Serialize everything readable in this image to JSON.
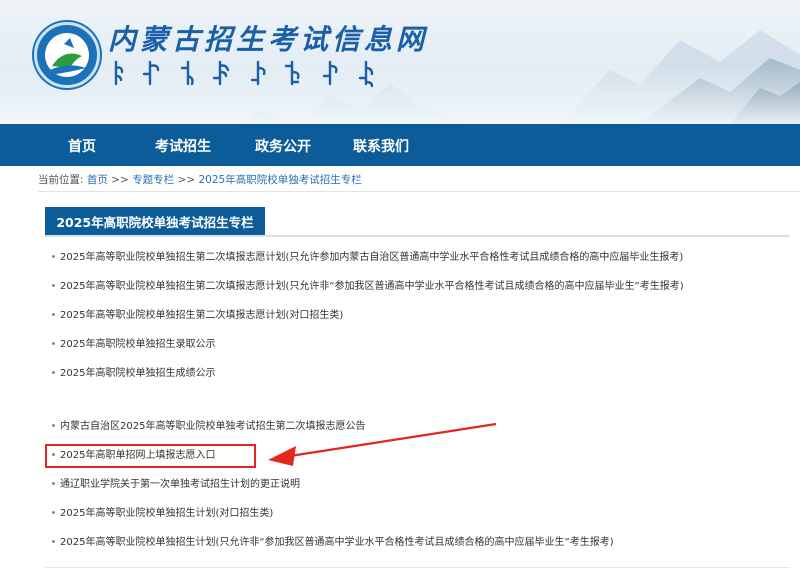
{
  "header": {
    "title": "内蒙古招生考试信息网"
  },
  "nav": {
    "items": [
      {
        "label": "首页"
      },
      {
        "label": "考试招生"
      },
      {
        "label": "政务公开"
      },
      {
        "label": "联系我们"
      }
    ]
  },
  "breadcrumb": {
    "prefix": "当前位置:",
    "home": "首页",
    "sep1": ">>",
    "topic": "专题专栏",
    "sep2": ">>",
    "current": "2025年高职院校单独考试招生专栏"
  },
  "section": {
    "title": "2025年高职院校单独考试招生专栏"
  },
  "list": {
    "items": [
      {
        "text": "2025年高等职业院校单独招生第二次填报志愿计划(只允许参加内蒙古自治区普通高中学业水平合格性考试且成绩合格的高中应届毕业生报考)"
      },
      {
        "text": "2025年高等职业院校单独招生第二次填报志愿计划(只允许非“参加我区普通高中学业水平合格性考试且成绩合格的高中应届毕业生”考生报考)"
      },
      {
        "text": "2025年高等职业院校单独招生第二次填报志愿计划(对口招生类)"
      },
      {
        "text": "2025年高职院校单独招生录取公示"
      },
      {
        "text": "2025年高职院校单独招生成绩公示"
      },
      {
        "text": "内蒙古自治区2025年高等职业院校单独考试招生第二次填报志愿公告"
      },
      {
        "text": "2025年高职单招网上填报志愿入口"
      },
      {
        "text": "通辽职业学院关于第一次单独考试招生计划的更正说明"
      },
      {
        "text": "2025年高等职业院校单独招生计划(对口招生类)"
      },
      {
        "text": "2025年高等职业院校单独招生计划(只允许非“参加我区普通高中学业水平合格性考试且成绩合格的高中应届毕业生”考生报考)"
      }
    ]
  },
  "colors": {
    "nav": "#0d5c9a",
    "link": "#2a6db3",
    "annotation": "#e3261f"
  }
}
